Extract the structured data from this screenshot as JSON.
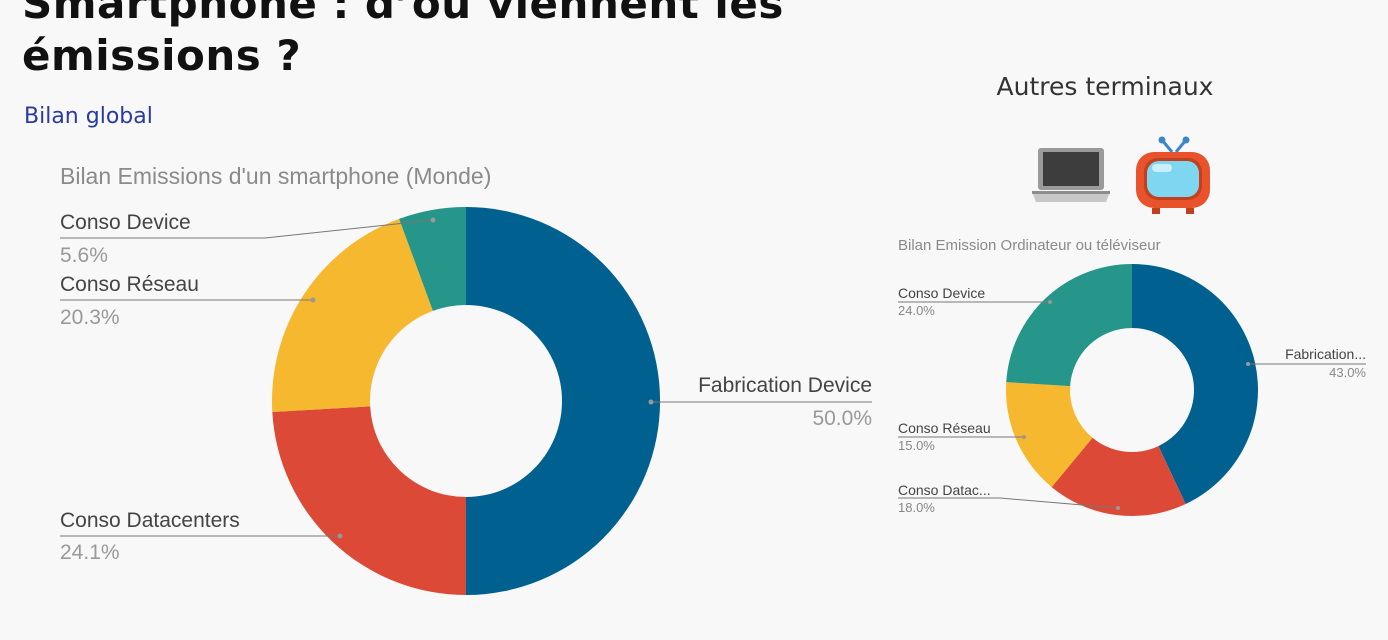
{
  "page": {
    "title_line1": "Smartphone : d’où viennent les",
    "title_line2": "émissions ?",
    "subtitle": "Bilan global",
    "right_heading": "Autres terminaux"
  },
  "icons": [
    "laptop-icon",
    "tv-icon"
  ],
  "colors": {
    "fabrication": "#006190",
    "datacenters": "#dc4a37",
    "reseau": "#f5b82e",
    "device": "#26968a"
  },
  "chart_data": [
    {
      "type": "pie",
      "donut": true,
      "title": "Bilan Emissions d'un smartphone (Monde)",
      "slices": [
        {
          "label": "Fabrication Device",
          "value": 50.0,
          "display": "50.0%",
          "color": "#006190"
        },
        {
          "label": "Conso Datacenters",
          "value": 24.1,
          "display": "24.1%",
          "color": "#dc4a37"
        },
        {
          "label": "Conso Réseau",
          "value": 20.3,
          "display": "20.3%",
          "color": "#f5b82e"
        },
        {
          "label": "Conso Device",
          "value": 5.6,
          "display": "5.6%",
          "color": "#26968a"
        }
      ]
    },
    {
      "type": "pie",
      "donut": true,
      "title": "Bilan Emission Ordinateur ou téléviseur",
      "slices": [
        {
          "label": "Fabrication...",
          "value": 43.0,
          "display": "43.0%",
          "color": "#006190"
        },
        {
          "label": "Conso Datac...",
          "value": 18.0,
          "display": "18.0%",
          "color": "#dc4a37"
        },
        {
          "label": "Conso Réseau",
          "value": 15.0,
          "display": "15.0%",
          "color": "#f5b82e"
        },
        {
          "label": "Conso Device",
          "value": 24.0,
          "display": "24.0%",
          "color": "#26968a"
        }
      ]
    }
  ]
}
